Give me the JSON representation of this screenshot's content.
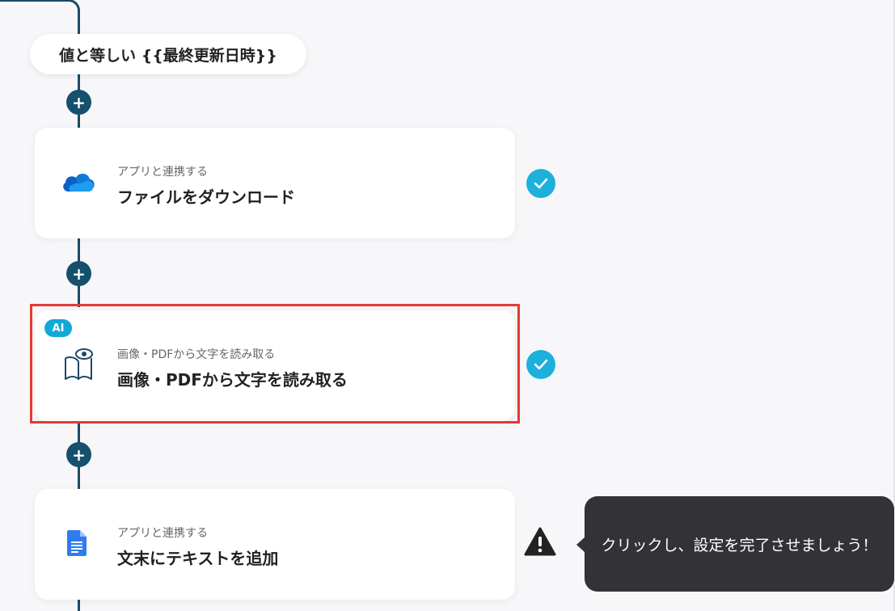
{
  "condition": {
    "label": "値と等しい {{最終更新日時}}"
  },
  "steps": [
    {
      "subtitle": "アプリと連携する",
      "title": "ファイルをダウンロード",
      "icon": "onedrive-icon",
      "status": "complete"
    },
    {
      "badge": "AI",
      "subtitle": "画像・PDFから文字を読み取る",
      "title": "画像・PDFから文字を読み取る",
      "icon": "ocr-book-eye-icon",
      "status": "complete"
    },
    {
      "subtitle": "アプリと連携する",
      "title": "文末にテキストを追加",
      "icon": "google-docs-icon",
      "status": "warning"
    }
  ],
  "add_button": {
    "symbol": "+"
  },
  "tooltip": {
    "text": "クリックし、設定を完了させましょう！"
  },
  "colors": {
    "line": "#1a4b64",
    "check": "#1eb0dc",
    "highlight": "#e53935",
    "tooltip_bg": "#333236"
  }
}
